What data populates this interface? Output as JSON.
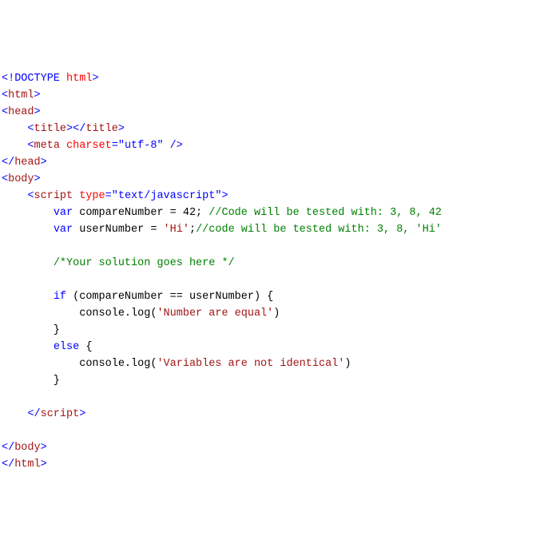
{
  "lines": [
    [
      {
        "t": "<!",
        "c": "blue"
      },
      {
        "t": "DOCTYPE",
        "c": "blue"
      },
      {
        "t": " ",
        "c": "black"
      },
      {
        "t": "html",
        "c": "red"
      },
      {
        "t": ">",
        "c": "blue"
      }
    ],
    [
      {
        "t": "<",
        "c": "blue"
      },
      {
        "t": "html",
        "c": "maroon"
      },
      {
        "t": ">",
        "c": "blue"
      }
    ],
    [
      {
        "t": "<",
        "c": "blue"
      },
      {
        "t": "head",
        "c": "maroon"
      },
      {
        "t": ">",
        "c": "blue"
      }
    ],
    [
      {
        "t": "    ",
        "c": "black"
      },
      {
        "t": "<",
        "c": "blue"
      },
      {
        "t": "title",
        "c": "maroon"
      },
      {
        "t": "></",
        "c": "blue"
      },
      {
        "t": "title",
        "c": "maroon"
      },
      {
        "t": ">",
        "c": "blue"
      }
    ],
    [
      {
        "t": "    ",
        "c": "black"
      },
      {
        "t": "<",
        "c": "blue"
      },
      {
        "t": "meta",
        "c": "maroon"
      },
      {
        "t": " ",
        "c": "black"
      },
      {
        "t": "charset",
        "c": "red"
      },
      {
        "t": "=\"utf-8\"",
        "c": "blue"
      },
      {
        "t": " />",
        "c": "blue"
      }
    ],
    [
      {
        "t": "</",
        "c": "blue"
      },
      {
        "t": "head",
        "c": "maroon"
      },
      {
        "t": ">",
        "c": "blue"
      }
    ],
    [
      {
        "t": "<",
        "c": "blue"
      },
      {
        "t": "body",
        "c": "maroon"
      },
      {
        "t": ">",
        "c": "blue"
      }
    ],
    [
      {
        "t": "    ",
        "c": "black"
      },
      {
        "t": "<",
        "c": "blue"
      },
      {
        "t": "script",
        "c": "maroon"
      },
      {
        "t": " ",
        "c": "black"
      },
      {
        "t": "type",
        "c": "red"
      },
      {
        "t": "=\"text/javascript\"",
        "c": "blue"
      },
      {
        "t": ">",
        "c": "blue"
      }
    ],
    [
      {
        "t": "        ",
        "c": "black"
      },
      {
        "t": "var",
        "c": "blue"
      },
      {
        "t": " compareNumber = 42; ",
        "c": "black"
      },
      {
        "t": "//Code will be tested with: 3, 8, 42",
        "c": "green"
      }
    ],
    [
      {
        "t": "        ",
        "c": "black"
      },
      {
        "t": "var",
        "c": "blue"
      },
      {
        "t": " userNumber = ",
        "c": "black"
      },
      {
        "t": "'Hi'",
        "c": "maroon"
      },
      {
        "t": ";",
        "c": "black"
      },
      {
        "t": "//code will be tested with: 3, 8, 'Hi'",
        "c": "green"
      }
    ],
    [
      {
        "t": " ",
        "c": "black"
      }
    ],
    [
      {
        "t": "        ",
        "c": "black"
      },
      {
        "t": "/*Your solution goes here */",
        "c": "green"
      }
    ],
    [
      {
        "t": " ",
        "c": "black"
      }
    ],
    [
      {
        "t": "        ",
        "c": "black"
      },
      {
        "t": "if",
        "c": "blue"
      },
      {
        "t": " (compareNumber == userNumber) {",
        "c": "black"
      }
    ],
    [
      {
        "t": "            console.log(",
        "c": "black"
      },
      {
        "t": "'Number are equal'",
        "c": "maroon"
      },
      {
        "t": ")",
        "c": "black"
      }
    ],
    [
      {
        "t": "        }",
        "c": "black"
      }
    ],
    [
      {
        "t": "        ",
        "c": "black"
      },
      {
        "t": "else",
        "c": "blue"
      },
      {
        "t": " {",
        "c": "black"
      }
    ],
    [
      {
        "t": "            console.log(",
        "c": "black"
      },
      {
        "t": "'Variables are not identical'",
        "c": "maroon"
      },
      {
        "t": ")",
        "c": "black"
      }
    ],
    [
      {
        "t": "        }",
        "c": "black"
      }
    ],
    [
      {
        "t": " ",
        "c": "black"
      }
    ],
    [
      {
        "t": "    ",
        "c": "black"
      },
      {
        "t": "</",
        "c": "blue"
      },
      {
        "t": "script",
        "c": "maroon"
      },
      {
        "t": ">",
        "c": "blue"
      }
    ],
    [
      {
        "t": " ",
        "c": "black"
      }
    ],
    [
      {
        "t": "</",
        "c": "blue"
      },
      {
        "t": "body",
        "c": "maroon"
      },
      {
        "t": ">",
        "c": "blue"
      }
    ],
    [
      {
        "t": "</",
        "c": "blue"
      },
      {
        "t": "html",
        "c": "maroon"
      },
      {
        "t": ">",
        "c": "blue"
      }
    ]
  ]
}
